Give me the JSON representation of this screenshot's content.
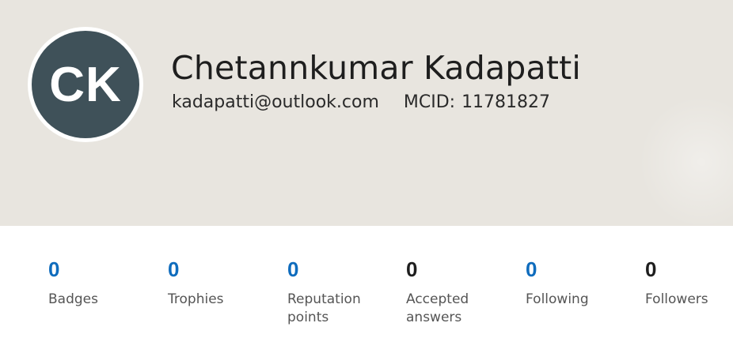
{
  "profile": {
    "initials": "CK",
    "name": "Chetannkumar Kadapatti",
    "email": "kadapatti@outlook.com",
    "mcid_label": "MCID:",
    "mcid_value": "11781827",
    "avatar_color": "#3f5159"
  },
  "stats": {
    "badges": {
      "count": "0",
      "label": "Badges"
    },
    "trophies": {
      "count": "0",
      "label": "Trophies"
    },
    "reputation": {
      "count": "0",
      "label_line1": "Reputation",
      "label_line2": "points"
    },
    "accepted": {
      "count": "0",
      "label_line1": "Accepted",
      "label_line2": "answers"
    },
    "following": {
      "count": "0",
      "label": "Following"
    },
    "followers": {
      "count": "0",
      "label": "Followers"
    }
  },
  "colors": {
    "link_blue": "#0f6cbd",
    "header_bg": "#e8e5df"
  }
}
